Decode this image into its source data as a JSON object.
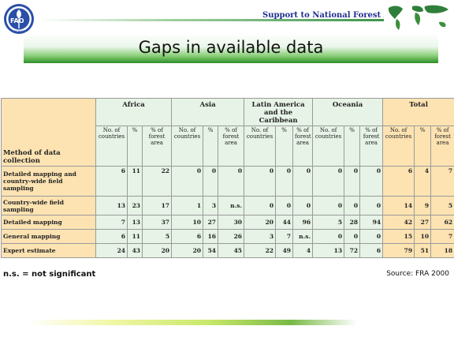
{
  "header": {
    "logo_text": "FAO",
    "logo_motto": "FIAT PANIS",
    "title": "Support to National Forest Assessment",
    "globe_icon": "world-map-icon"
  },
  "banner": {
    "title": "Gaps in available data"
  },
  "table": {
    "method_header": "Method of data collection",
    "regions": [
      "Africa",
      "Asia",
      "Latin America and the Caribbean",
      "Oceania",
      "Total"
    ],
    "subheaders": [
      "No. of countries",
      "%",
      "% of forest area"
    ],
    "rows": [
      {
        "label": "Detailed mapping and country-wide field sampling",
        "values": [
          "6",
          "11",
          "22",
          "0",
          "0",
          "0",
          "0",
          "0",
          "0",
          "0",
          "0",
          "0",
          "6",
          "4",
          "7"
        ]
      },
      {
        "label": "Country-wide field sampling",
        "values": [
          "13",
          "23",
          "17",
          "1",
          "3",
          "n.s.",
          "0",
          "0",
          "0",
          "0",
          "0",
          "0",
          "14",
          "9",
          "5"
        ]
      },
      {
        "label": "Detailed mapping",
        "values": [
          "7",
          "13",
          "37",
          "10",
          "27",
          "30",
          "20",
          "44",
          "96",
          "5",
          "28",
          "94",
          "42",
          "27",
          "62"
        ]
      },
      {
        "label": "General mapping",
        "values": [
          "6",
          "11",
          "5",
          "6",
          "16",
          "26",
          "3",
          "7",
          "n.s.",
          "0",
          "0",
          "0",
          "15",
          "10",
          "7"
        ]
      },
      {
        "label": "Expert estimate",
        "values": [
          "24",
          "43",
          "20",
          "20",
          "54",
          "45",
          "22",
          "49",
          "4",
          "13",
          "72",
          "6",
          "79",
          "51",
          "18"
        ]
      }
    ]
  },
  "footer": {
    "note": "n.s. = not significant",
    "source": "Source: FRA 2000"
  },
  "colors": {
    "region_bg": "#e6f3e6",
    "method_bg": "#fde3b2",
    "header_title": "#1f2f8f",
    "banner_dark": "#2f8f2a"
  }
}
